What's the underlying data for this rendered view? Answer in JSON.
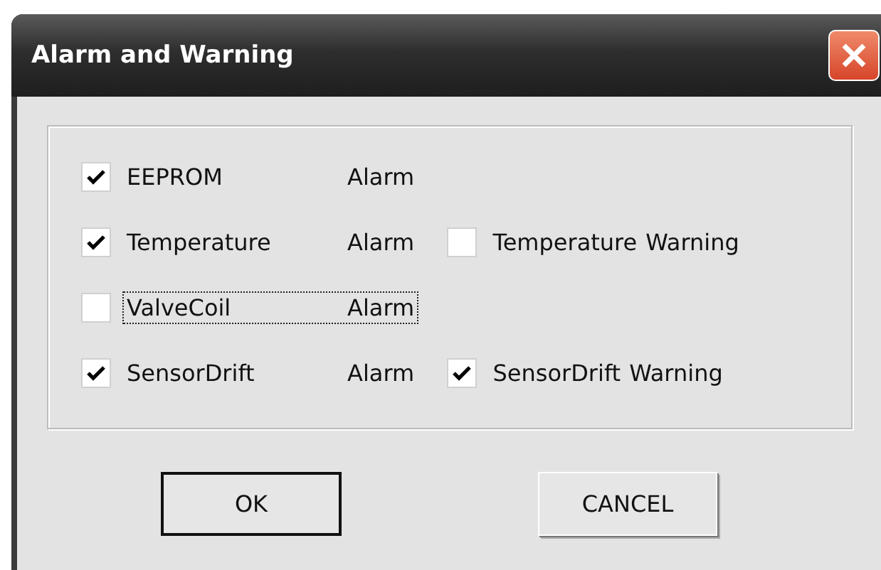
{
  "window": {
    "title": "Alarm and Warning"
  },
  "rows": [
    {
      "items": [
        {
          "name": "EEPROM",
          "suffix": "Alarm",
          "checked": true,
          "focused": false
        }
      ]
    },
    {
      "items": [
        {
          "name": "Temperature",
          "suffix": "Alarm",
          "checked": true,
          "focused": false
        },
        {
          "name": "Temperature",
          "suffix": "Warning",
          "checked": false,
          "focused": false
        }
      ]
    },
    {
      "items": [
        {
          "name": "ValveCoil",
          "suffix": "Alarm",
          "checked": false,
          "focused": true
        }
      ]
    },
    {
      "items": [
        {
          "name": "SensorDrift",
          "suffix": "Alarm",
          "checked": true,
          "focused": false
        },
        {
          "name": "SensorDrift",
          "suffix": "Warning",
          "checked": true,
          "focused": false
        }
      ]
    }
  ],
  "buttons": [
    {
      "label": "OK",
      "default": true
    },
    {
      "label": "CANCEL",
      "default": false
    }
  ]
}
